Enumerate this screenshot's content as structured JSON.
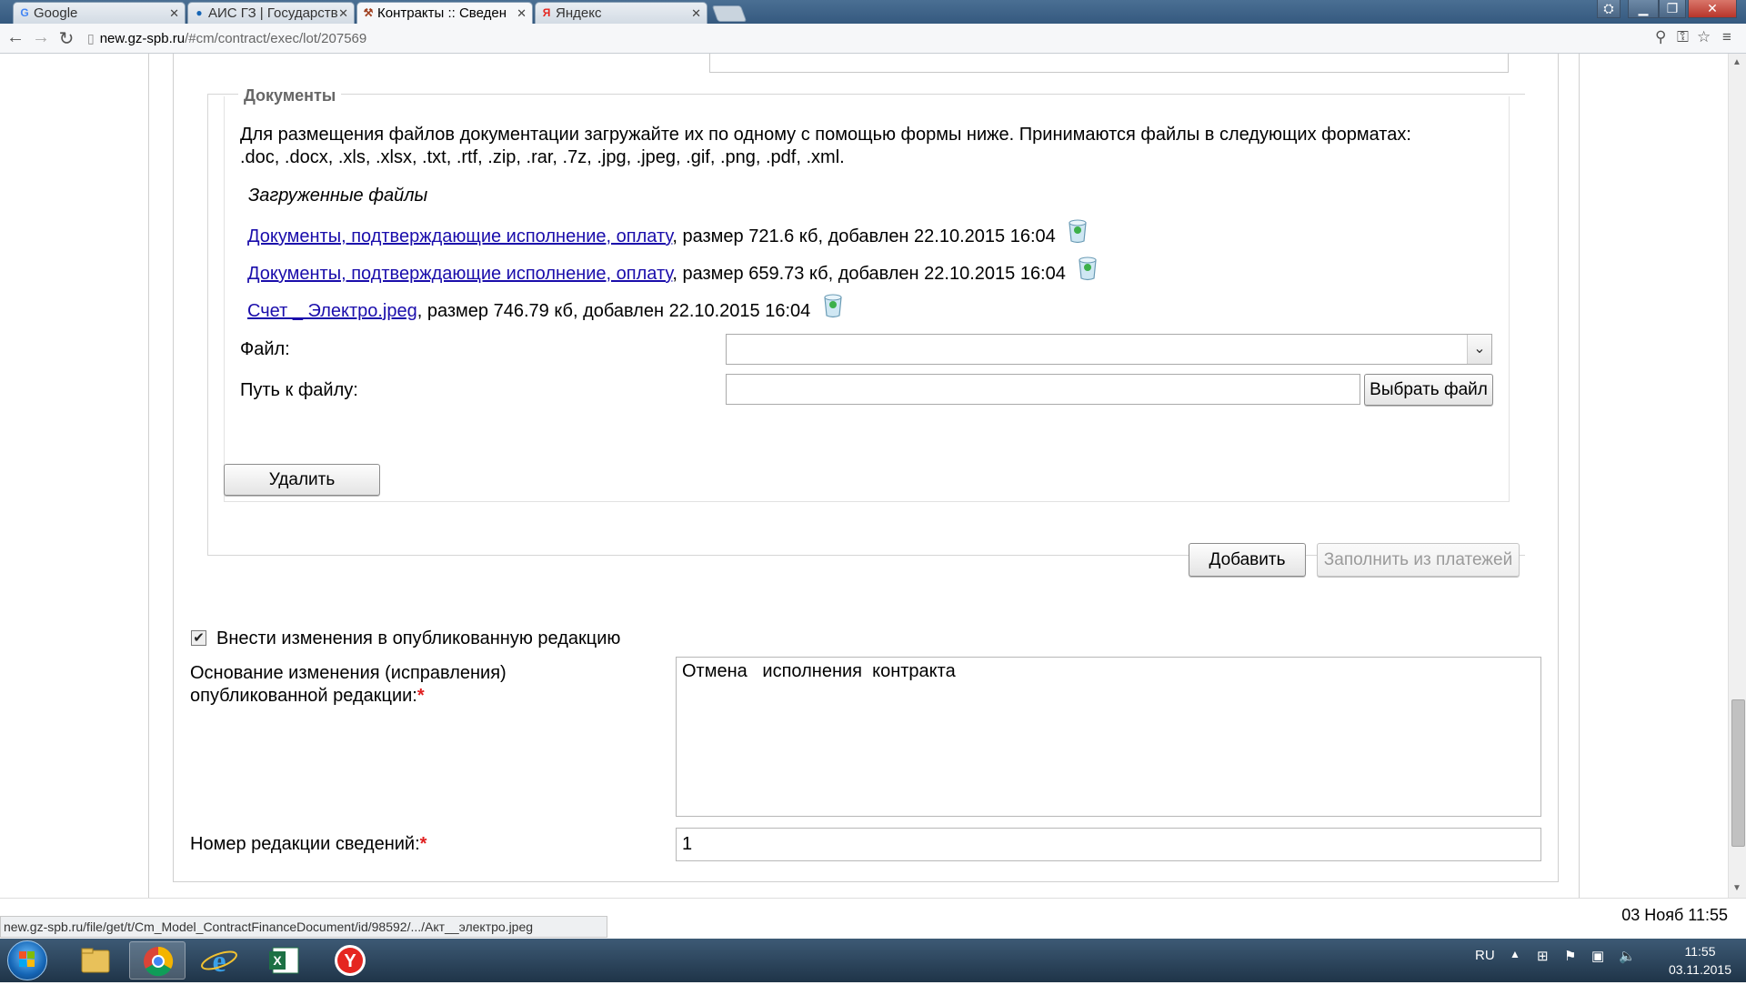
{
  "browser": {
    "tabs": [
      {
        "label": "Google",
        "favicon": "G"
      },
      {
        "label": "АИС ГЗ | Государств",
        "favicon": "●"
      },
      {
        "label": "Контракты :: Сведен",
        "favicon": "⚒"
      },
      {
        "label": "Яндекс",
        "favicon": "Я"
      }
    ],
    "url_host": "new.gz-spb.ru",
    "url_path": "/#cm/contract/exec/lot/207569"
  },
  "documents": {
    "legend": "Документы",
    "instructions_line1": "Для размещения файлов документации загружайте их по одному с помощью формы ниже. Принимаются файлы в следующих форматах:",
    "instructions_line2": ".doc, .docx, .xls, .xlsx, .txt, .rtf, .zip, .rar, .7z, .jpg, .jpeg, .gif, .png, .pdf, .xml.",
    "uploaded_heading": "Загруженные файлы",
    "files": [
      {
        "name": "Документы, подтверждающие исполнение, оплату",
        "info": ", размер 721.6 кб, добавлен 22.10.2015 16:04"
      },
      {
        "name": "Документы, подтверждающие исполнение, оплату",
        "info": ", размер 659.73 кб, добавлен 22.10.2015 16:04"
      },
      {
        "name": "Счет _ Электро.jpeg",
        "info": ", размер 746.79 кб, добавлен 22.10.2015 16:04"
      }
    ],
    "file_label": "Файл:",
    "file_value": "",
    "path_label": "Путь к файлу:",
    "path_value": "",
    "choose_file_button": "Выбрать файл"
  },
  "actions": {
    "delete_button": "Удалить",
    "add_button": "Добавить",
    "fill_from_payments_button": "Заполнить из платежей"
  },
  "edition": {
    "checkbox_label": "Внести изменения в опубликованную редакцию",
    "checkbox_checked": true,
    "reason_label_line1": "Основание изменения (исправления)",
    "reason_label_line2": "опубликованной редакции:",
    "required_mark": "*",
    "reason_value": "Отмена   исполнения  контракта",
    "number_label": "Номер редакции сведений:",
    "number_value": "1"
  },
  "status": {
    "hover_url": "new.gz-spb.ru/file/get/t/Cm_Model_ContractFinanceDocument/id/98592/.../Акт__электро.jpeg",
    "page_datetime": "03 Нояб 11:55",
    "footer_mark": "©"
  },
  "taskbar": {
    "lang": "RU",
    "time": "11:55",
    "date": "03.11.2015"
  },
  "colors": {
    "link": "#1a0dab",
    "required": "#e02020"
  }
}
